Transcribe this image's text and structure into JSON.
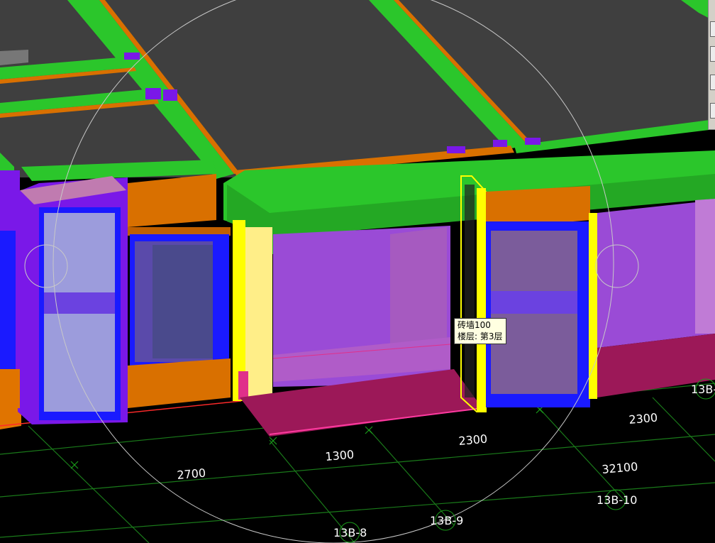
{
  "tooltip": {
    "line1": "砖墙100",
    "line2": "楼层: 第3层"
  },
  "dimensions": {
    "d1": "2700",
    "d2": "1300",
    "d3": "2300",
    "d4": "2300",
    "d5": "32100"
  },
  "axes": {
    "a1": "13B-8",
    "a2": "13B-9",
    "a3": "13B-10",
    "a4": "13B-"
  },
  "colors": {
    "background": "#000000",
    "roof": "#3f3f3f",
    "beam_green": "#2bc62b",
    "beam_orange": "#d97000",
    "column_purple": "#7a18e8",
    "window_frame": "#1a1aff",
    "wall_violet": "#9a4bd6",
    "floor_magenta": "#9c1858",
    "wall_yellow": "#ffff00",
    "grid_green": "#1a7a1a"
  }
}
